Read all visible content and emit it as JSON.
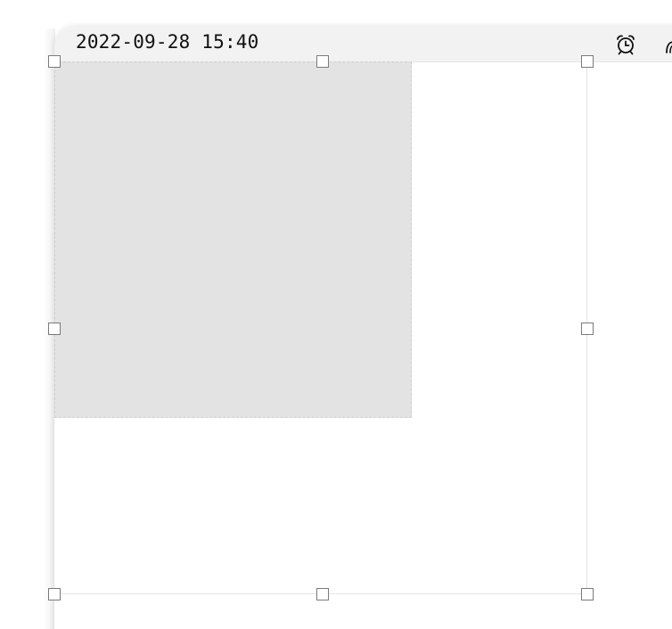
{
  "header": {
    "datetime": "2022-09-28 15:40"
  },
  "icons": {
    "alarm": "alarm-clock-icon",
    "partial": "partial-icon"
  },
  "colors": {
    "header_background": "#f2f2f2",
    "placeholder_fill": "#e3e3e3",
    "handle_border": "#7a7a7a",
    "frame_border": "#e3e3e3"
  }
}
